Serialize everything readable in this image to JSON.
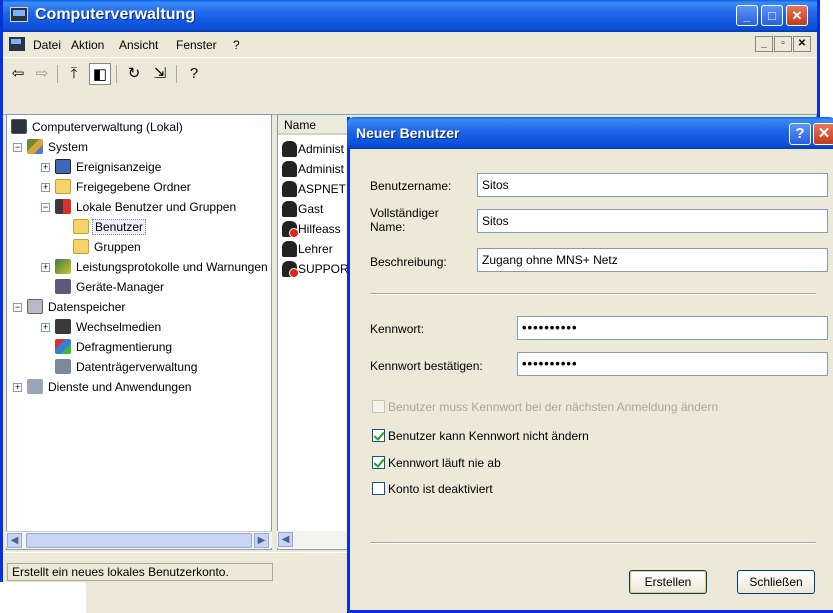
{
  "main": {
    "title": "Computerverwaltung",
    "menu": [
      "Datei",
      "Aktion",
      "Ansicht",
      "Fenster",
      "?"
    ],
    "tree": [
      {
        "label": "Computerverwaltung (Lokal)",
        "icon": "computer-icon"
      },
      {
        "label": "System",
        "icon": "system-tools-icon"
      },
      {
        "label": "Ereignisanzeige",
        "icon": "event-viewer-icon"
      },
      {
        "label": "Freigegebene Ordner",
        "icon": "shared-folders-icon"
      },
      {
        "label": "Lokale Benutzer und Gruppen",
        "icon": "local-users-icon"
      },
      {
        "label": "Benutzer",
        "icon": "folder-icon"
      },
      {
        "label": "Gruppen",
        "icon": "folder-icon"
      },
      {
        "label": "Leistungsprotokolle und Warnungen",
        "icon": "performance-icon"
      },
      {
        "label": "Geräte-Manager",
        "icon": "device-manager-icon"
      },
      {
        "label": "Datenspeicher",
        "icon": "storage-icon"
      },
      {
        "label": "Wechselmedien",
        "icon": "removable-media-icon"
      },
      {
        "label": "Defragmentierung",
        "icon": "defrag-icon"
      },
      {
        "label": "Datenträgerverwaltung",
        "icon": "disk-management-icon"
      },
      {
        "label": "Dienste und Anwendungen",
        "icon": "services-icon"
      }
    ],
    "list": {
      "column": "Name",
      "users": [
        {
          "name": "Administ",
          "disabled": false
        },
        {
          "name": "Administ",
          "disabled": false
        },
        {
          "name": "ASPNET",
          "disabled": false
        },
        {
          "name": "Gast",
          "disabled": false
        },
        {
          "name": "Hilfeass",
          "disabled": true
        },
        {
          "name": "Lehrer",
          "disabled": false
        },
        {
          "name": "SUPPOR",
          "disabled": true
        }
      ]
    },
    "status": "Erstellt ein neues lokales Benutzerkonto."
  },
  "dialog": {
    "title": "Neuer Benutzer",
    "help_label": "?",
    "fields": {
      "username_label": "Benutzername:",
      "username_value": "Sitos",
      "fullname_label": "Vollständiger Name:",
      "fullname_value": "Sitos",
      "description_label": "Beschreibung:",
      "description_value": "Zugang ohne MNS+ Netz",
      "password_label": "Kennwort:",
      "password_value": "••••••••••",
      "confirm_label": "Kennwort bestätigen:",
      "confirm_value": "••••••••••"
    },
    "checkboxes": [
      {
        "label": "Benutzer muss Kennwort bei der nächsten Anmeldung ändern",
        "checked": false,
        "disabled": true
      },
      {
        "label": "Benutzer kann Kennwort nicht ändern",
        "checked": true,
        "disabled": false
      },
      {
        "label": "Kennwort läuft nie ab",
        "checked": true,
        "disabled": false
      },
      {
        "label": "Konto ist deaktiviert",
        "checked": false,
        "disabled": false
      }
    ],
    "buttons": {
      "create": "Erstellen",
      "close": "Schließen"
    }
  },
  "colors": {
    "titlebar": "#0a4fd6",
    "window_face": "#ece9d8",
    "check": "#21a121",
    "disabled_badge": "#e0201a"
  }
}
